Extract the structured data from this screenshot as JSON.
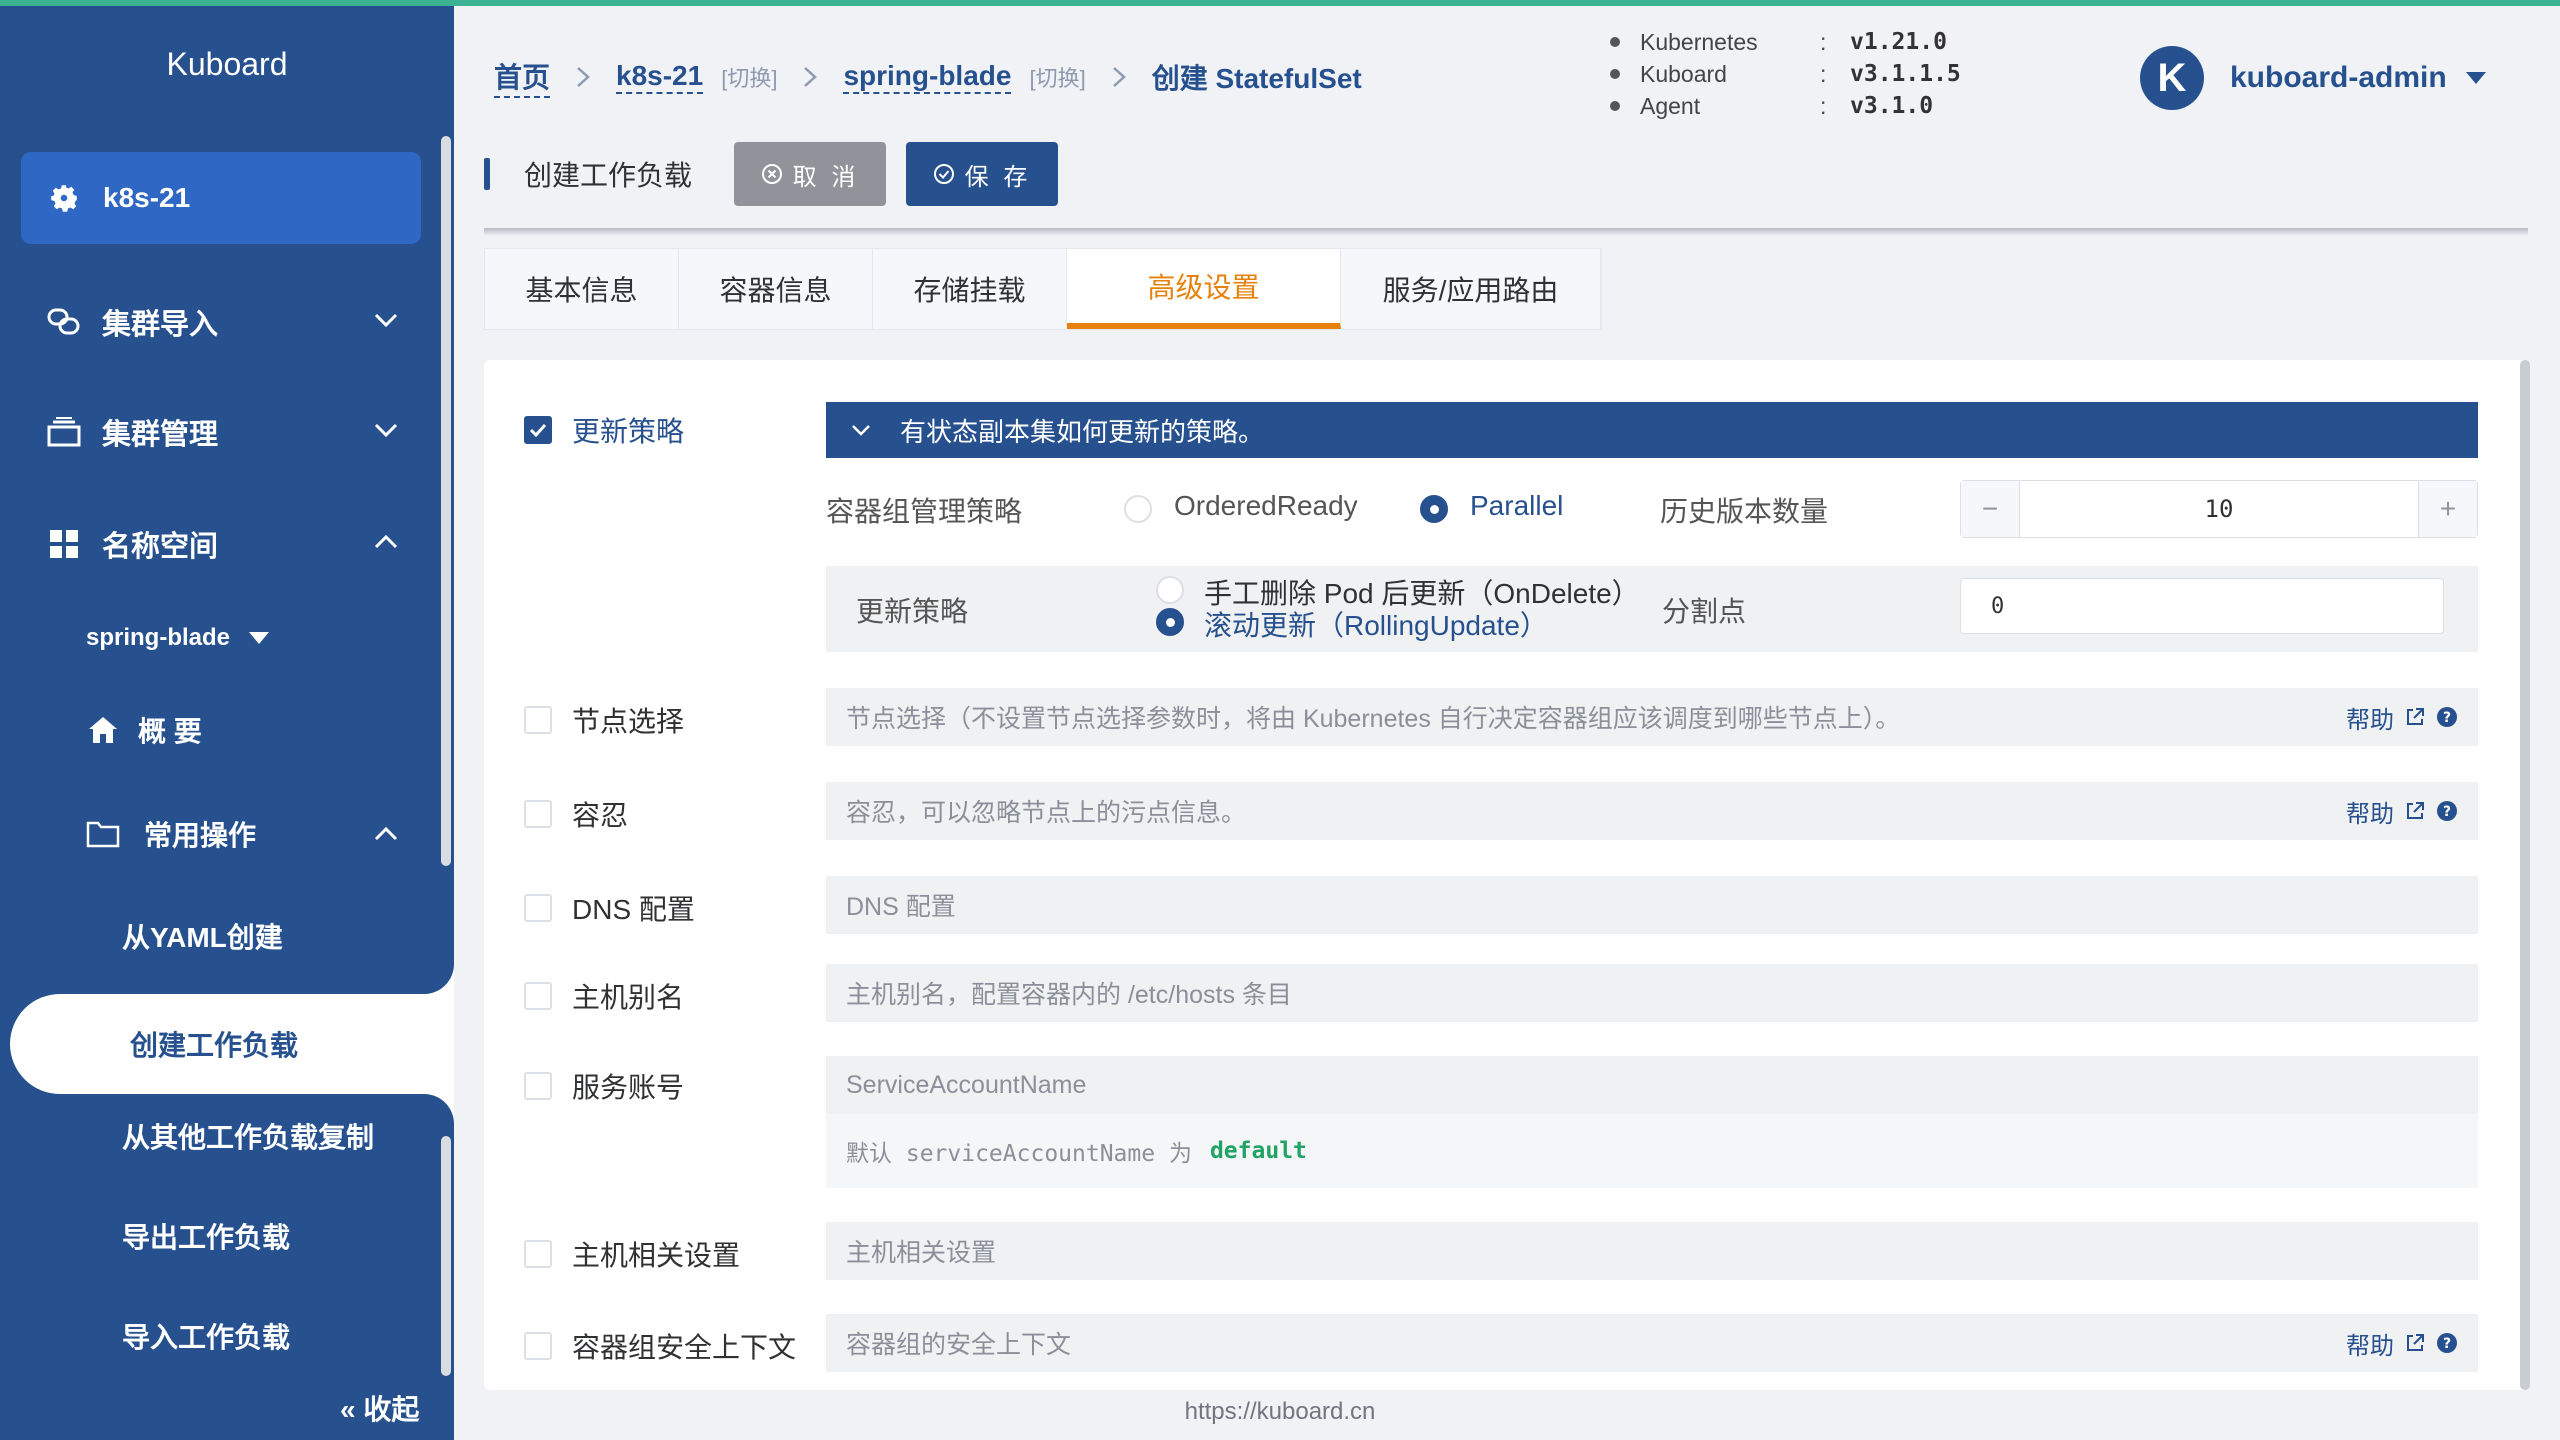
{
  "colors": {
    "accent": "#27518e",
    "active_tab": "#e6820b",
    "top_line": "#3bb392",
    "default_text": "#21a366"
  },
  "sidebar": {
    "brand": "Kuboard",
    "cluster": "k8s-21",
    "menu": [
      {
        "label": "集群导入",
        "icon": "link-icon"
      },
      {
        "label": "集群管理",
        "icon": "server-icon"
      },
      {
        "label": "名称空间",
        "icon": "grid-icon"
      }
    ],
    "namespace": "spring-blade",
    "overview": "概 要",
    "common_ops": "常用操作",
    "items": [
      "从YAML创建",
      "创建工作负载",
      "从其他工作负载复制",
      "导出工作负载",
      "导入工作负载"
    ],
    "collapse": "« 收起"
  },
  "breadcrumb": {
    "home": "首页",
    "cluster": "k8s-21",
    "switch": "[切换]",
    "namespace": "spring-blade",
    "current": "创建 StatefulSet"
  },
  "versions": [
    {
      "name": "Kubernetes",
      "value": "v1.21.0"
    },
    {
      "name": "Kuboard",
      "value": "v3.1.1.5"
    },
    {
      "name": "Agent",
      "value": "v3.1.0"
    }
  ],
  "user": {
    "initial": "K",
    "name": "kuboard-admin"
  },
  "title": "创建工作负载",
  "buttons": {
    "cancel": "取 消",
    "save": "保 存"
  },
  "tabs": [
    "基本信息",
    "容器信息",
    "存储挂载",
    "高级设置",
    "服务/应用路由"
  ],
  "update": {
    "label": "更新策略",
    "bar_text": "有状态副本集如何更新的策略。",
    "pod_mgmt_label": "容器组管理策略",
    "opt_ordered": "OrderedReady",
    "opt_parallel": "Parallel",
    "history_label": "历史版本数量",
    "history_value": "10",
    "strategy_label": "更新策略",
    "opt_ondelete": "手工删除 Pod 后更新（OnDelete）",
    "opt_rolling": "滚动更新（RollingUpdate）",
    "partition_label": "分割点",
    "partition_value": "0"
  },
  "rows": {
    "node": {
      "label": "节点选择",
      "placeholder": "节点选择（不设置节点选择参数时，将由 Kubernetes 自行决定容器组应该调度到哪些节点上）。",
      "help": "帮助"
    },
    "toleration": {
      "label": "容忍",
      "placeholder": "容忍，可以忽略节点上的污点信息。",
      "help": "帮助"
    },
    "dns": {
      "label": "DNS 配置",
      "placeholder": "DNS 配置"
    },
    "hosts": {
      "label": "主机别名",
      "placeholder": "主机别名，配置容器内的 /etc/hosts 条目"
    },
    "sa": {
      "label": "服务账号",
      "placeholder": "ServiceAccountName",
      "note": "默认 serviceAccountName 为",
      "note_value": "default"
    },
    "host": {
      "label": "主机相关设置",
      "placeholder": "主机相关设置"
    },
    "security": {
      "label": "容器组安全上下文",
      "placeholder": "容器组的安全上下文",
      "help": "帮助"
    }
  },
  "footer": "https://kuboard.cn"
}
